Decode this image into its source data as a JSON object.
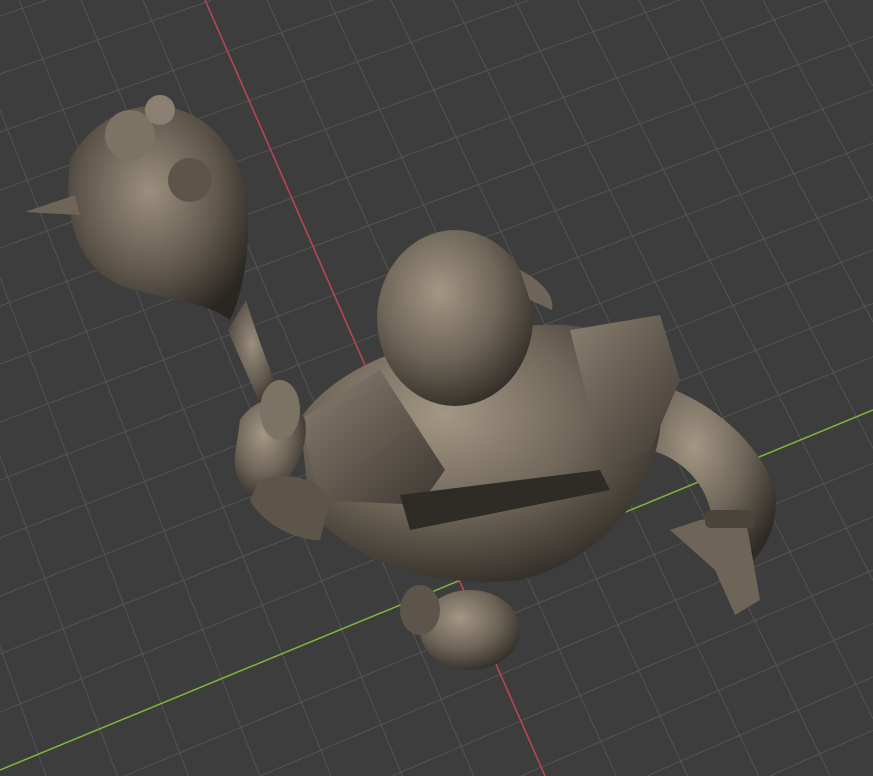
{
  "viewport": {
    "kind": "3d-viewport",
    "object": "sculpted-warrior-with-club",
    "colors": {
      "background": "#3d3d3d",
      "grid": "#545454",
      "x_axis": "#c04454",
      "y_axis": "#7cb83a",
      "model_light": "#9a8e7e",
      "model_mid": "#6b6255",
      "model_dark": "#2e2a25"
    }
  }
}
